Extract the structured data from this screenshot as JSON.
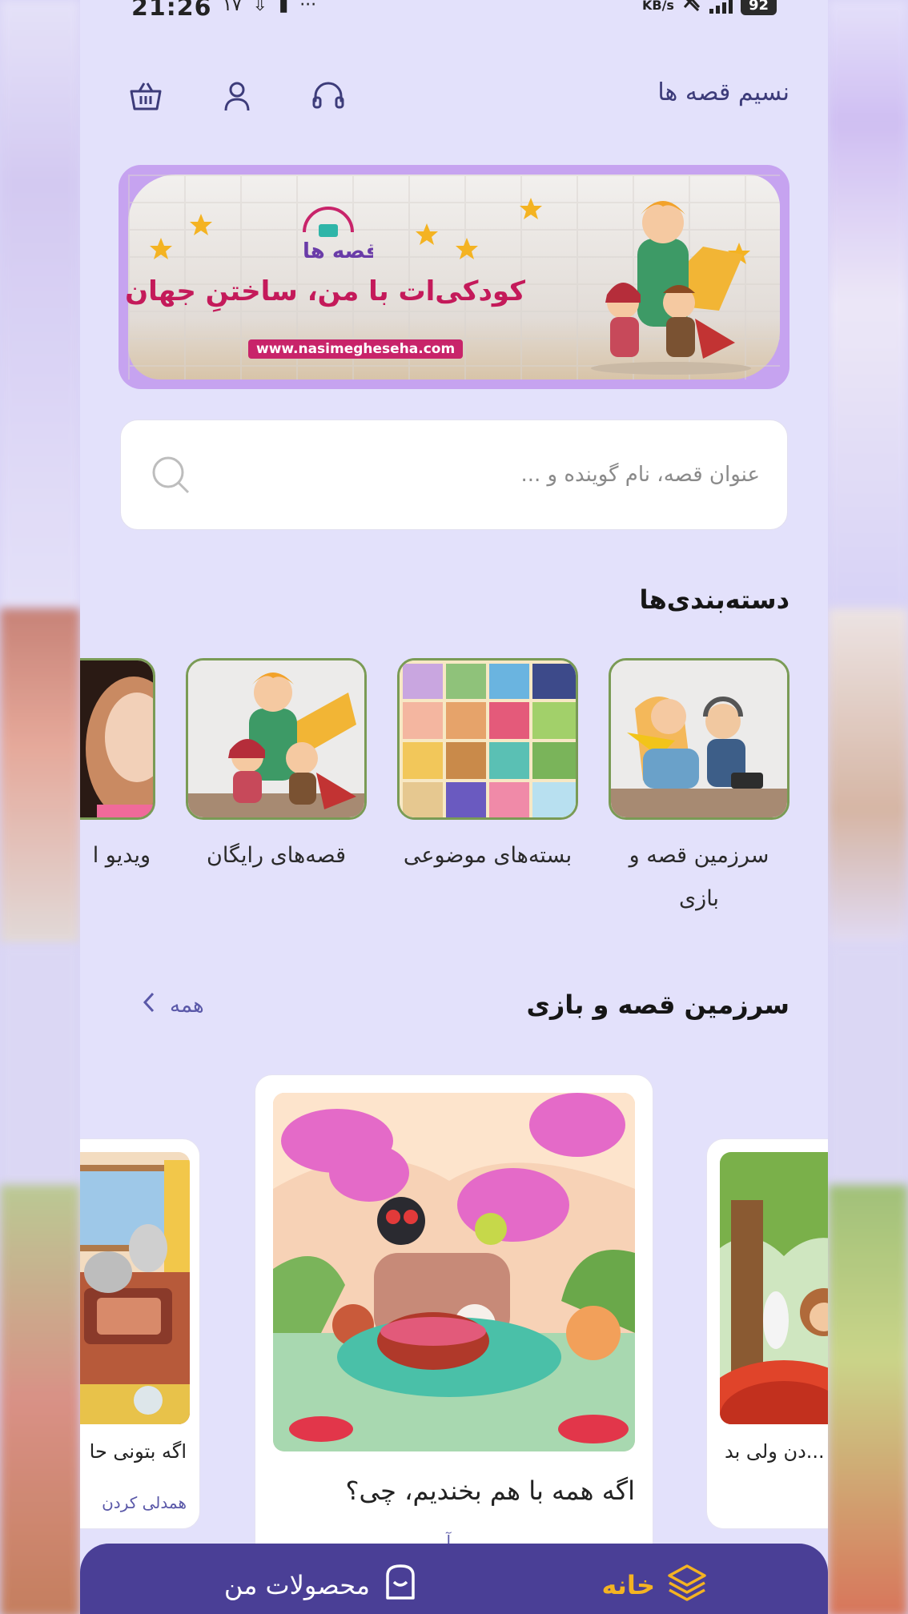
{
  "status_bar": {
    "time": "21:26",
    "small_number": "۱۷",
    "data_speed_unit": "KB/s",
    "battery": "92"
  },
  "header": {
    "app_title": "نسیم قصه ها",
    "icons": [
      "basket-icon",
      "user-icon",
      "headphones-icon"
    ]
  },
  "banner": {
    "tagline": "کودکی‌ات با من، ساختنِ جهان با تو",
    "url": "www.nasimegheseha.com",
    "logo_text": "قصه ها"
  },
  "search": {
    "placeholder": "عنوان قصه، نام گوینده و ..."
  },
  "categories": {
    "title": "دسته‌بندی‌ها",
    "items": [
      {
        "label": "سرزمین قصه و بازی"
      },
      {
        "label": "بسته‌های موضوعی"
      },
      {
        "label": "قصه‌های رایگان"
      },
      {
        "label": "ویدیو ا"
      }
    ]
  },
  "stories": {
    "title": "سرزمین قصه و بازی",
    "see_all": "همه",
    "items": [
      {
        "title": "اگه همه با هم بخندیم، چی؟",
        "tag": "آ"
      },
      {
        "title": "اگه بتونی حا",
        "tag": "همدلی کردن"
      },
      {
        "title": "...دن ولی بد",
        "tag": ""
      }
    ]
  },
  "bottom_nav": {
    "home": "خانه",
    "products": "محصولات من"
  },
  "colors": {
    "background": "#e3e1fb",
    "accent": "#4a3f96",
    "active_nav": "#f4b322",
    "title_text": "#3d3c7a"
  }
}
